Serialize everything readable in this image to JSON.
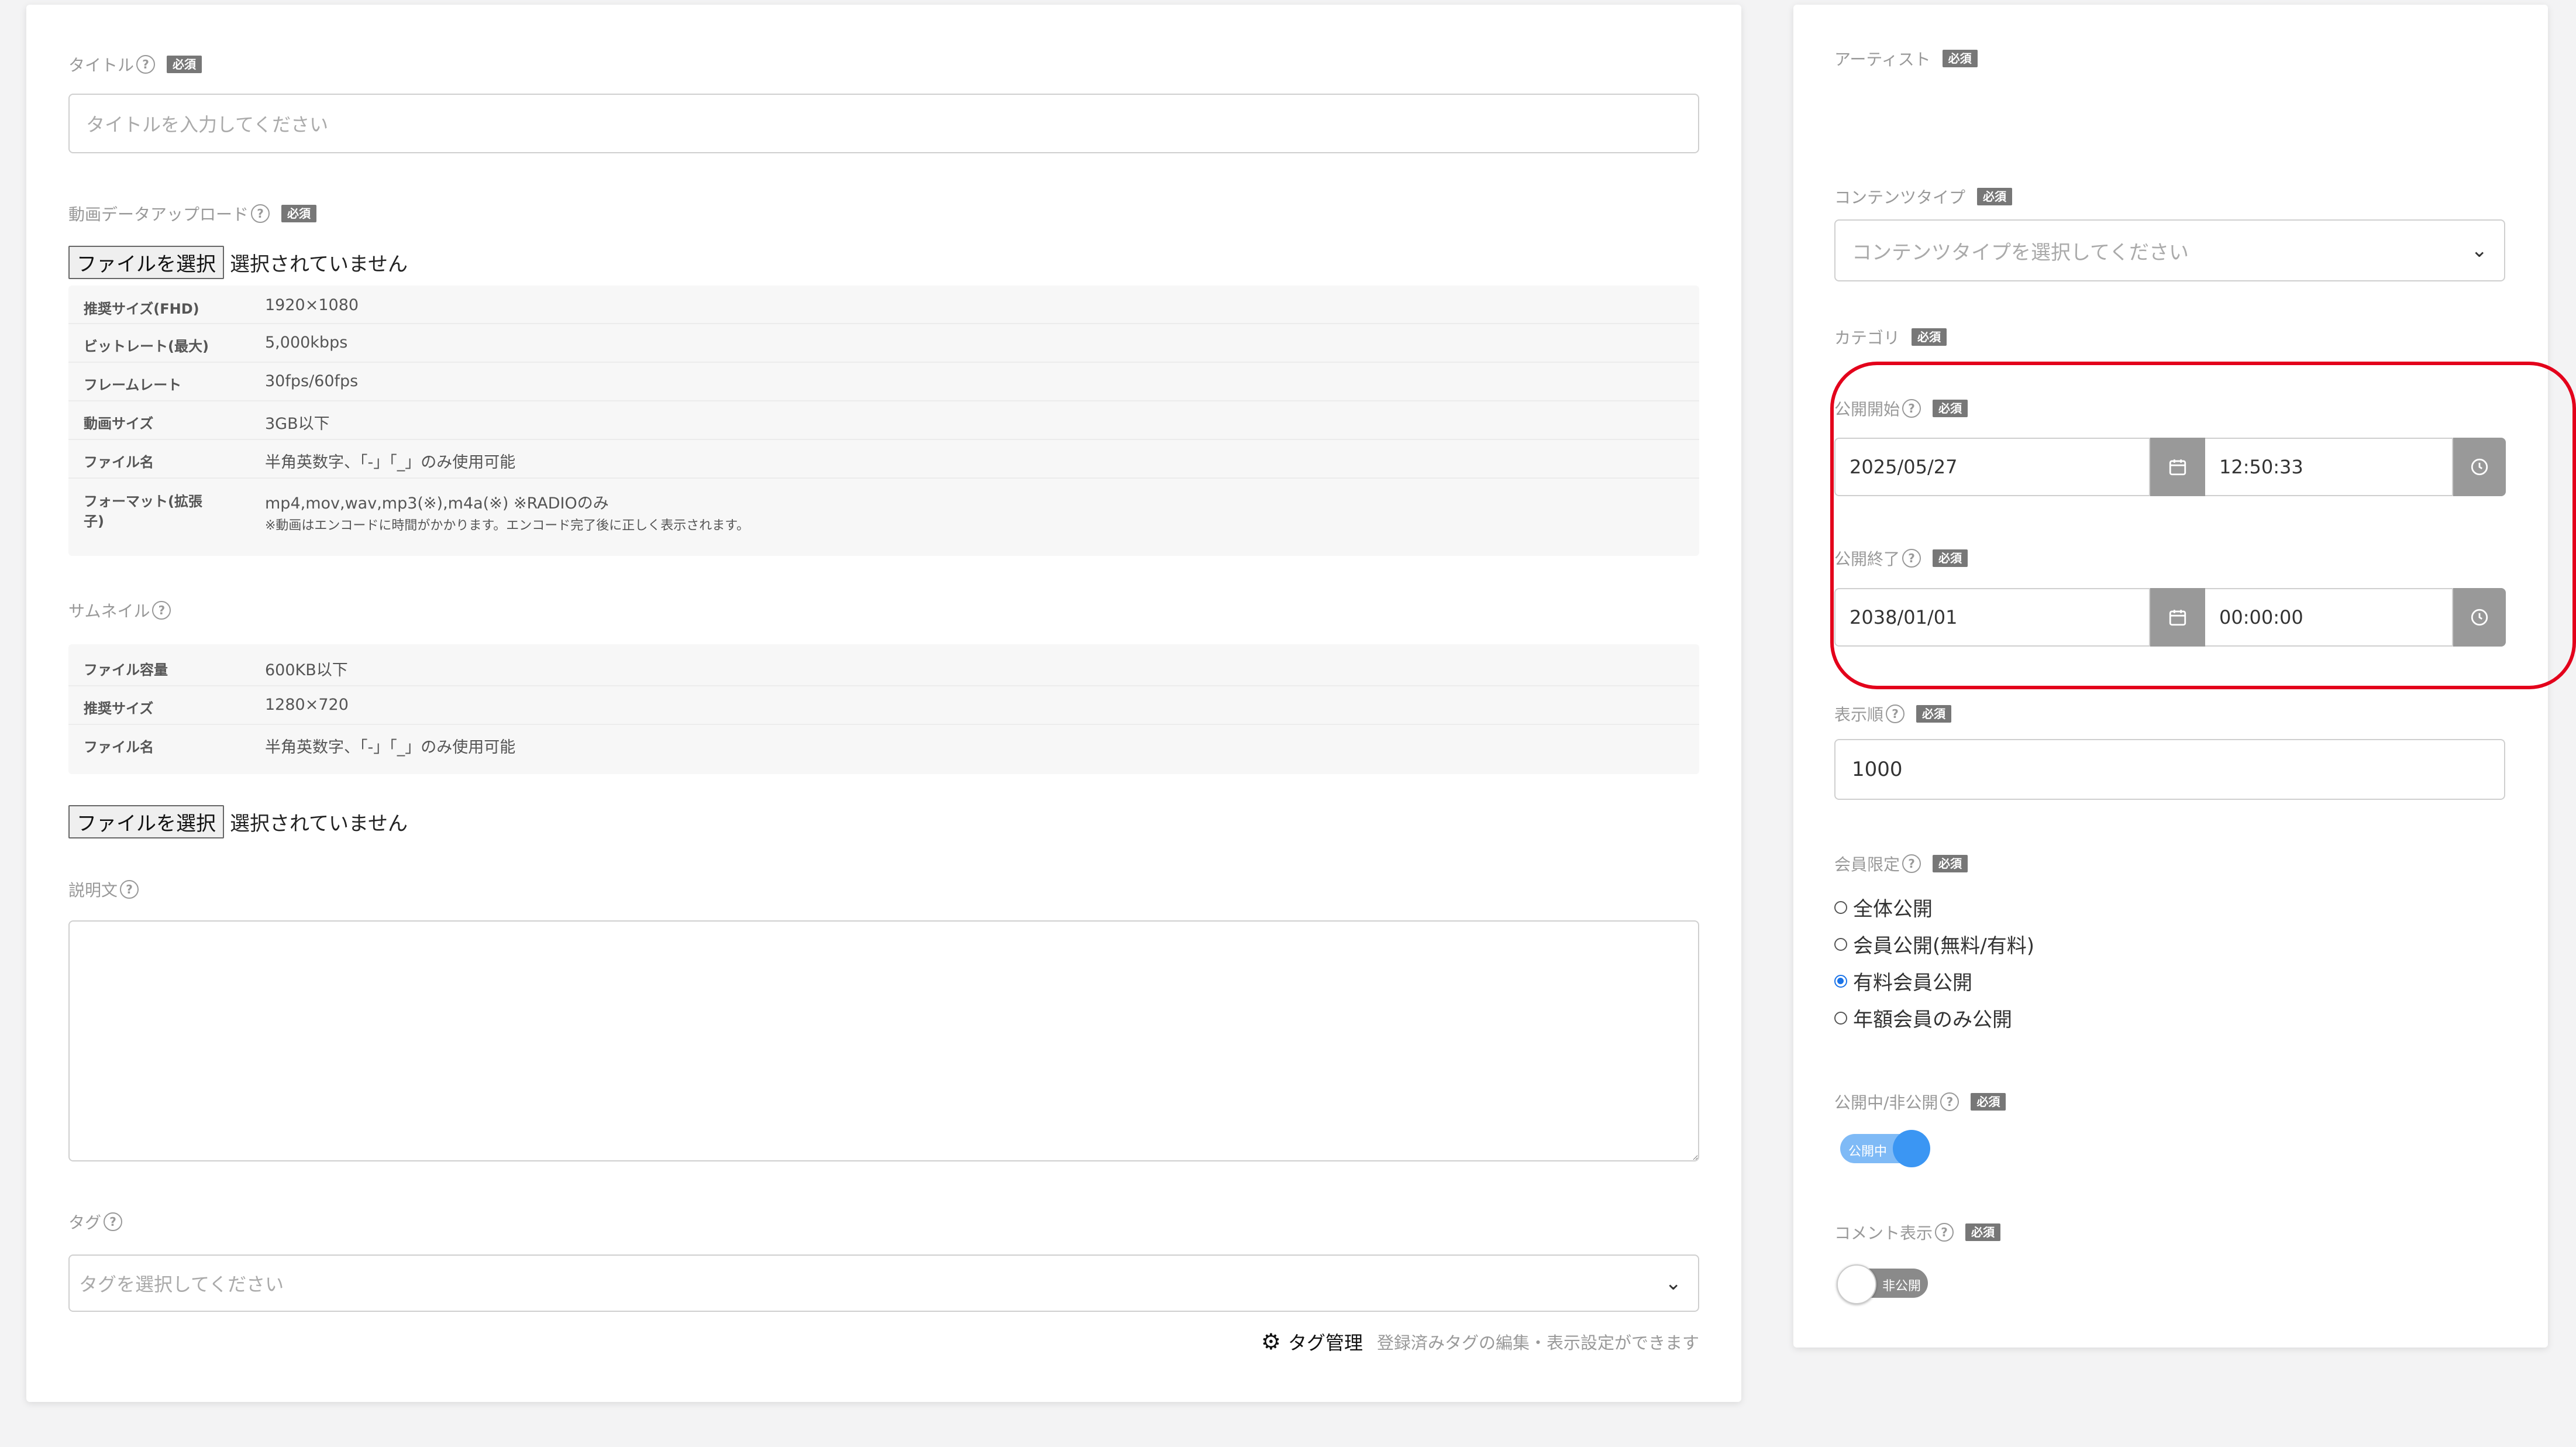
{
  "left": {
    "title": {
      "label": "タイトル",
      "required": "必須",
      "placeholder": "タイトルを入力してください"
    },
    "video_upload": {
      "label": "動画データアップロード",
      "required": "必須",
      "button": "ファイルを選択",
      "status": "選択されていません",
      "specs": [
        {
          "key": "推奨サイズ(FHD)",
          "value": "1920×1080"
        },
        {
          "key": "ビットレート(最大)",
          "value": "5,000kbps"
        },
        {
          "key": "フレームレート",
          "value": "30fps/60fps"
        },
        {
          "key": "動画サイズ",
          "value": "3GB以下"
        },
        {
          "key": "ファイル名",
          "value": "半角英数字、「-」「_」のみ使用可能"
        },
        {
          "key": "フォーマット(拡張子)",
          "value": "mp4,mov,wav,mp3(※),m4a(※) ※RADIOのみ",
          "note": "※動画はエンコードに時間がかかります。エンコード完了後に正しく表示されます。"
        }
      ]
    },
    "thumbnail": {
      "label": "サムネイル",
      "specs": [
        {
          "key": "ファイル容量",
          "value": "600KB以下"
        },
        {
          "key": "推奨サイズ",
          "value": "1280×720"
        },
        {
          "key": "ファイル名",
          "value": "半角英数字、「-」「_」のみ使用可能"
        }
      ],
      "button": "ファイルを選択",
      "status": "選択されていません"
    },
    "description": {
      "label": "説明文"
    },
    "tags": {
      "label": "タグ",
      "placeholder": "タグを選択してください",
      "manage_label": "タグ管理",
      "manage_hint": "登録済みタグの編集・表示設定ができます"
    }
  },
  "right": {
    "artist": {
      "label": "アーティスト",
      "required": "必須"
    },
    "content_type": {
      "label": "コンテンツタイプ",
      "required": "必須",
      "placeholder": "コンテンツタイプを選択してください"
    },
    "category": {
      "label": "カテゴリ",
      "required": "必須"
    },
    "publish_start": {
      "label": "公開開始",
      "required": "必須",
      "date": "2025/05/27",
      "time": "12:50:33"
    },
    "publish_end": {
      "label": "公開終了",
      "required": "必須",
      "date": "2038/01/01",
      "time": "00:00:00"
    },
    "display_order": {
      "label": "表示順",
      "required": "必須",
      "value": "1000"
    },
    "membership": {
      "label": "会員限定",
      "required": "必須",
      "options": [
        "全体公開",
        "会員公開(無料/有料)",
        "有料会員公開",
        "年額会員のみ公開"
      ],
      "selected_index": 2
    },
    "visibility": {
      "label": "公開中/非公開",
      "required": "必須",
      "state_text": "公開中",
      "on": true
    },
    "comments": {
      "label": "コメント表示",
      "required": "必須",
      "state_text": "非公開",
      "on": false
    }
  },
  "colors": {
    "background": "#f3f3f4",
    "required_badge": "#777777",
    "toggle_on": "#4a9ff5",
    "toggle_off": "#888888",
    "radio_selected": "#1a73e8",
    "highlight": "#e3001b"
  }
}
